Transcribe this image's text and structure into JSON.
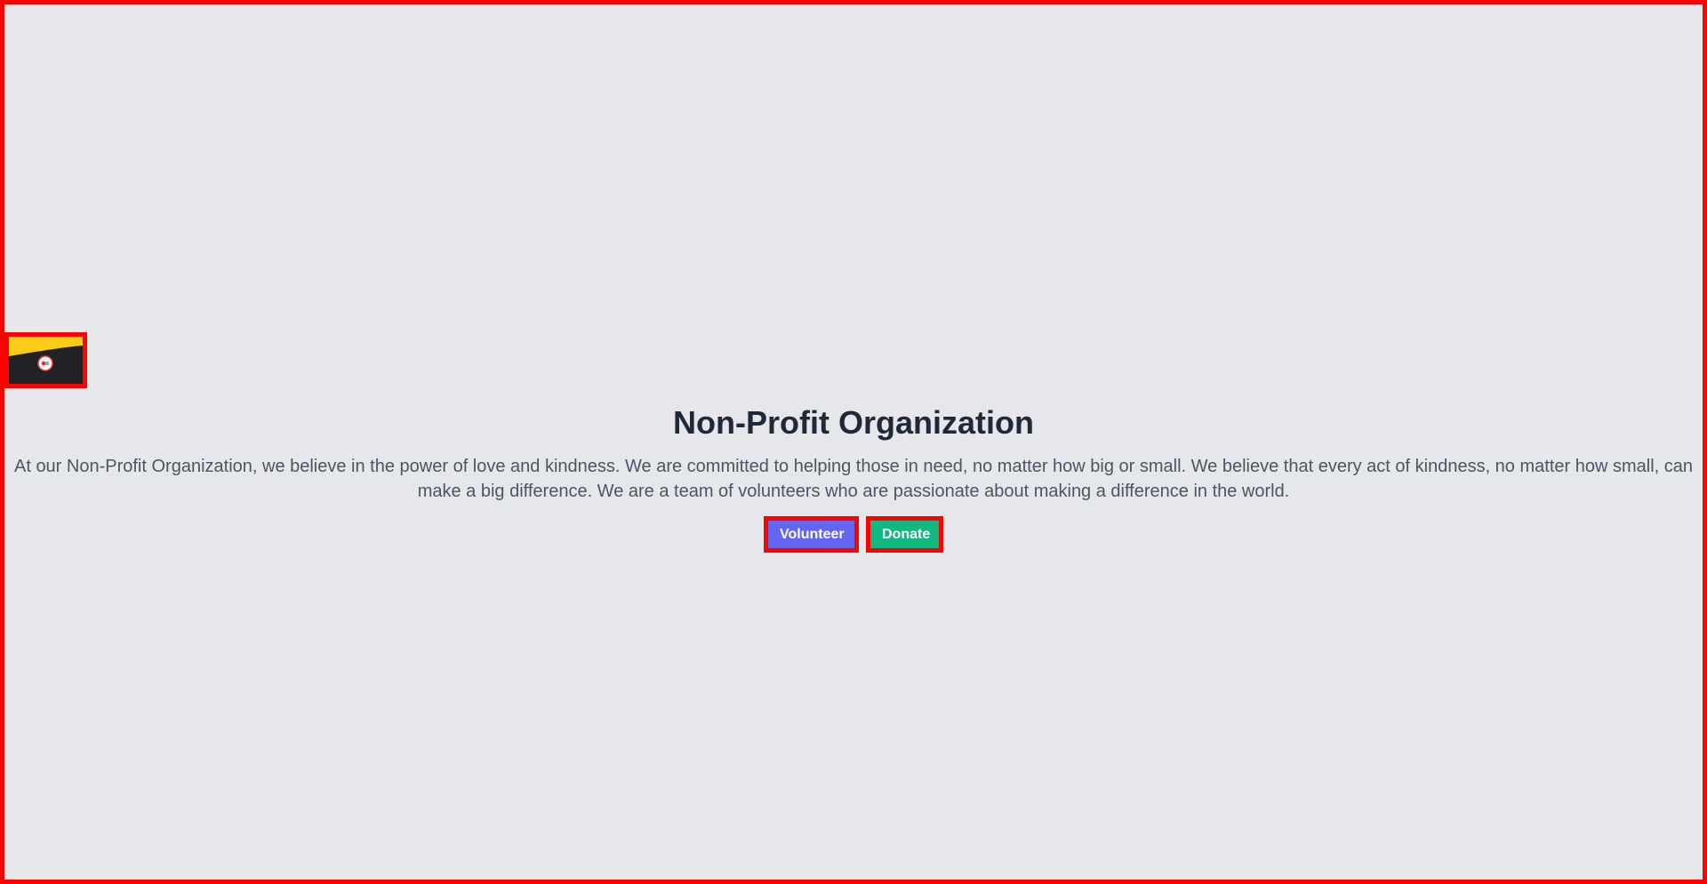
{
  "hero": {
    "title": "Non-Profit Organization",
    "description": "At our Non-Profit Organization, we believe in the power of love and kindness. We are committed to helping those in need, no matter how big or small. We believe that every act of kindness, no matter how small, can make a big difference. We are a team of volunteers who are passionate about making a difference in the world.",
    "image_icon": "broken-hero-image-icon"
  },
  "actions": {
    "volunteer_label": "Volunteer",
    "donate_label": "Donate"
  },
  "colors": {
    "background": "#e5e7eb",
    "volunteer": "#6366f1",
    "donate": "#10b981",
    "title": "#1f2937",
    "description": "#4b5563",
    "highlight": "#ff0000"
  }
}
